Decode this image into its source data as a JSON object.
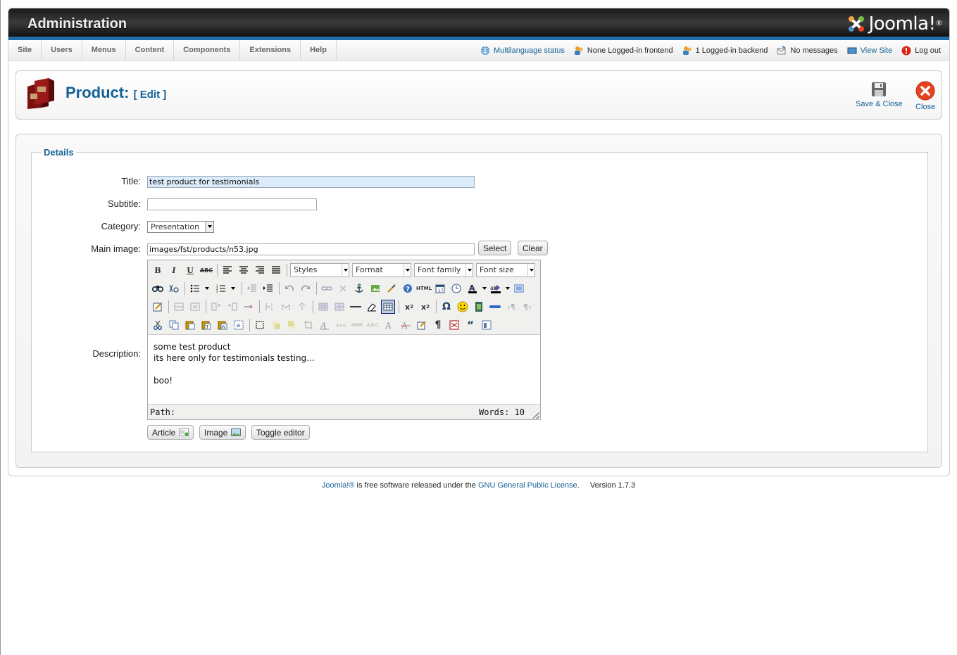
{
  "header": {
    "title": "Administration",
    "logo_text": "Joomla!",
    "logo_mark": "®"
  },
  "menu": {
    "items": [
      {
        "label": "Site"
      },
      {
        "label": "Users"
      },
      {
        "label": "Menus"
      },
      {
        "label": "Content"
      },
      {
        "label": "Components"
      },
      {
        "label": "Extensions"
      },
      {
        "label": "Help"
      }
    ]
  },
  "status": {
    "multilanguage": "Multilanguage status",
    "frontend": "None Logged-in frontend",
    "backend": "1 Logged-in backend",
    "messages": "No messages",
    "view_site": "View Site",
    "logout": "Log out"
  },
  "toolbar": {
    "title": "Product:",
    "subtitle": "[ Edit ]",
    "save_close": "Save & Close",
    "close": "Close"
  },
  "form": {
    "legend": "Details",
    "title_label": "Title:",
    "title_value": "test product for testimonials",
    "subtitle_label": "Subtitle:",
    "subtitle_value": "",
    "category_label": "Category:",
    "category_value": "Presentation",
    "image_label": "Main image:",
    "image_value": "images/fst/products/n53.jpg",
    "select_label": "Select",
    "clear_label": "Clear",
    "description_label": "Description:"
  },
  "editor": {
    "styles": "Styles",
    "format": "Format",
    "font_family": "Font family",
    "font_size": "Font size",
    "content": {
      "line1": "some test product",
      "line2": "its here only for testimonials testing...",
      "line3": "boo!"
    },
    "path_label": "Path:",
    "words": "Words: 10"
  },
  "editor_buttons": {
    "article": "Article",
    "image": "Image",
    "toggle": "Toggle editor"
  },
  "footer": {
    "joomla": "Joomla!®",
    "text": " is free software released under the ",
    "license": "GNU General Public License",
    "version": "Version 1.7.3"
  },
  "colors": {
    "accent": "#146295",
    "header_dark": "#1a1a1a",
    "header_bar": "#1f6da8",
    "close_red": "#e8411e"
  }
}
